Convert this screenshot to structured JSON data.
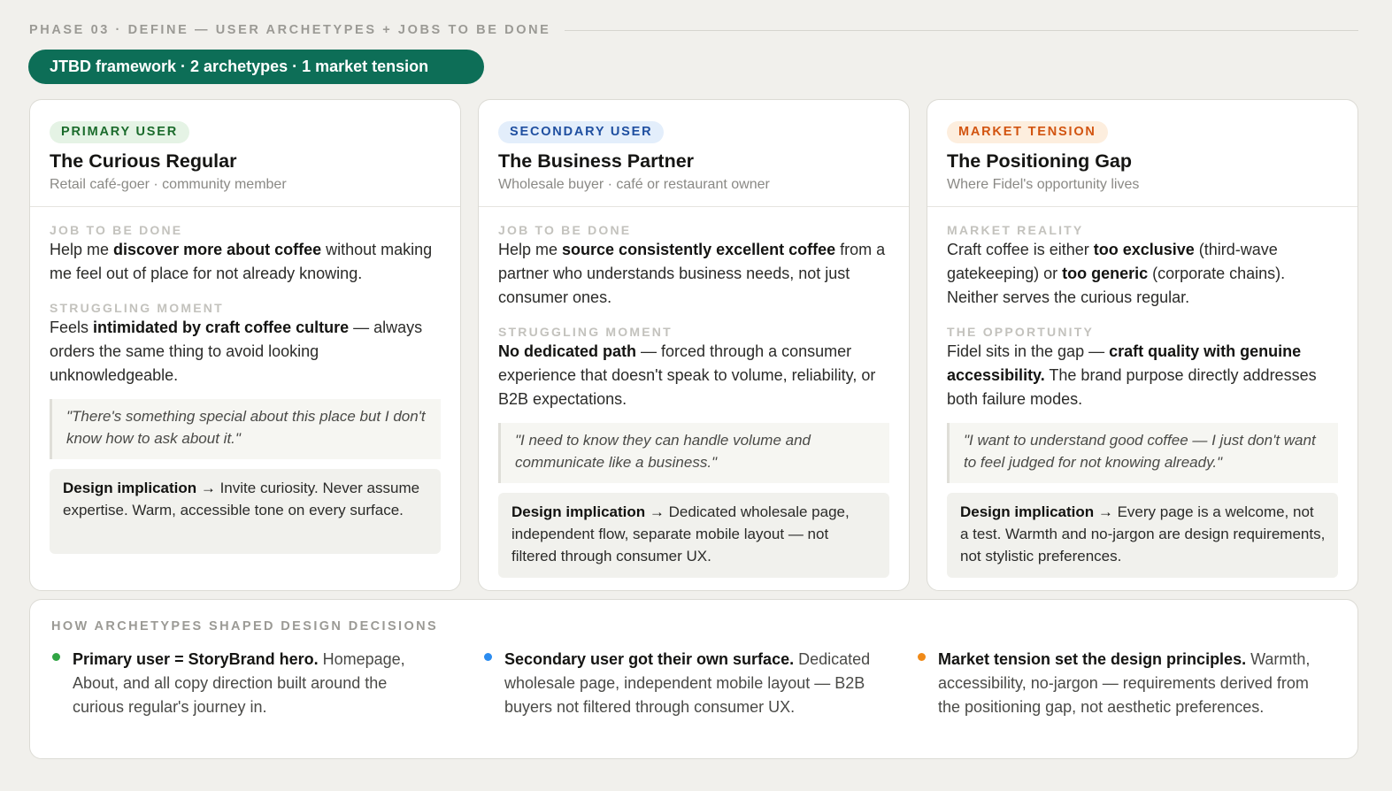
{
  "phase": {
    "label": "PHASE 03 · DEFINE — USER ARCHETYPES + JOBS TO BE DONE"
  },
  "pill": {
    "label": "JTBD framework · 2 archetypes · 1 market tension"
  },
  "colors": {
    "accent": "#0d6e57",
    "green": "#31a544",
    "blue": "#2b8cf0",
    "orange": "#f08a18"
  },
  "cards": [
    {
      "badge": "PRIMARY USER",
      "title": "The Curious Regular",
      "subtitle": "Retail café-goer · community member",
      "label1": "JOB TO BE DONE",
      "text1": {
        "a": "Help me ",
        "b": "discover more about coffee",
        "c": " without making me feel out of place for not already knowing."
      },
      "label2": "STRUGGLING MOMENT",
      "text2": {
        "a": "Feels ",
        "b": "intimidated by craft coffee culture",
        "c": " — always orders the same thing to avoid looking unknowledgeable."
      },
      "quote": "\"There's something special about this place but I don't know how to ask about it.\"",
      "implication": {
        "b": "Design implication →",
        "c": " Invite curiosity. Never assume expertise. Warm, accessible tone on every surface."
      }
    },
    {
      "badge": "SECONDARY USER",
      "title": "The Business Partner",
      "subtitle": "Wholesale buyer · café or restaurant owner",
      "label1": "JOB TO BE DONE",
      "text1": {
        "a": "Help me ",
        "b": "source consistently excellent coffee",
        "c": " from a partner who understands business needs, not just consumer ones."
      },
      "label2": "STRUGGLING MOMENT",
      "text2": {
        "a": "",
        "b": "No dedicated path",
        "c": " — forced through a consumer experience that doesn't speak to volume, reliability, or B2B expectations."
      },
      "quote": "\"I need to know they can handle volume and communicate like a business.\"",
      "implication": {
        "b": "Design implication →",
        "c": " Dedicated wholesale page, independent flow, separate mobile layout — not filtered through consumer UX."
      }
    },
    {
      "badge": "MARKET TENSION",
      "title": "The Positioning Gap",
      "subtitle": "Where Fidel's opportunity lives",
      "label1": "MARKET REALITY",
      "text1": {
        "a": "Craft coffee is either ",
        "b": "too exclusive",
        "c": " (third-wave gatekeeping) or ",
        "d": "too generic",
        "e": " (corporate chains). Neither serves the curious regular."
      },
      "label2": "THE OPPORTUNITY",
      "text2": {
        "a": "Fidel sits in the gap — ",
        "b": "craft quality with genuine accessibility.",
        "c": " The brand purpose directly addresses both failure modes."
      },
      "quote": "\"I want to understand good coffee — I just don't want to feel judged for not knowing already.\"",
      "implication": {
        "b": "Design implication →",
        "c": " Every page is a welcome, not a test. Warmth and no-jargon are design requirements, not stylistic preferences."
      }
    }
  ],
  "decisions": {
    "label": "HOW ARCHETYPES SHAPED DESIGN DECISIONS",
    "items": [
      {
        "bold": "Primary user = StoryBrand hero.",
        "text": " Homepage, About, and all copy direction built around the curious regular's journey in."
      },
      {
        "bold": "Secondary user got their own surface.",
        "text": " Dedicated wholesale page, independent mobile layout — B2B buyers not filtered through consumer UX."
      },
      {
        "bold": "Market tension set the design principles.",
        "text": " Warmth, accessibility, no-jargon — requirements derived from the positioning gap, not aesthetic preferences."
      }
    ]
  }
}
